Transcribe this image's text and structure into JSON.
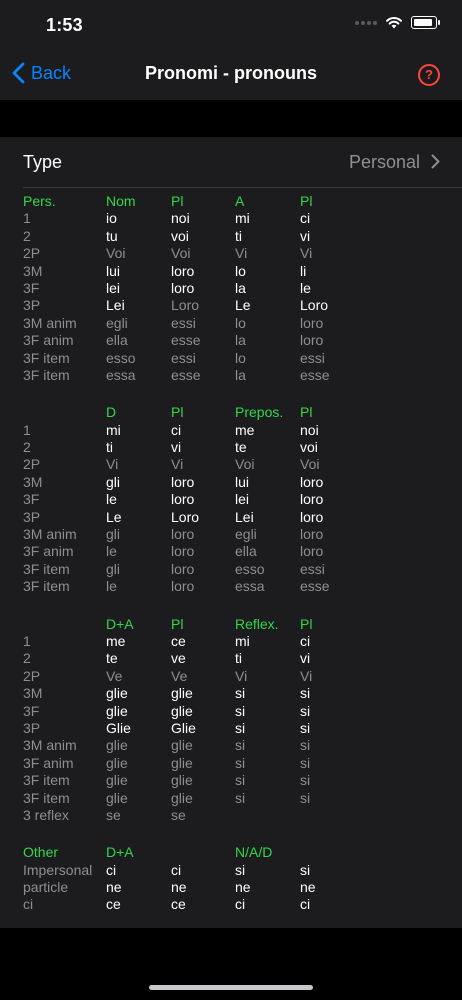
{
  "status": {
    "time": "1:53"
  },
  "nav": {
    "back_label": "Back",
    "title": "Pronomi - pronouns",
    "help_glyph": "?"
  },
  "type_row": {
    "label": "Type",
    "value": "Personal"
  },
  "tables": [
    {
      "header": [
        "Pers.",
        "Nom",
        "Pl",
        "A",
        "Pl"
      ],
      "rows": [
        {
          "c": [
            "1",
            "io",
            "noi",
            "mi",
            "ci"
          ],
          "s": [
            "g",
            "w",
            "w",
            "w",
            "w"
          ]
        },
        {
          "c": [
            "2",
            "tu",
            "voi",
            "ti",
            "vi"
          ],
          "s": [
            "g",
            "w",
            "w",
            "w",
            "w"
          ]
        },
        {
          "c": [
            "2P",
            "Voi",
            "Voi",
            "Vi",
            "Vi"
          ],
          "s": [
            "g",
            "g",
            "g",
            "g",
            "g"
          ]
        },
        {
          "c": [
            "3M",
            "lui",
            "loro",
            "lo",
            "li"
          ],
          "s": [
            "g",
            "w",
            "w",
            "w",
            "w"
          ]
        },
        {
          "c": [
            "3F",
            "lei",
            "loro",
            "la",
            "le"
          ],
          "s": [
            "g",
            "w",
            "w",
            "w",
            "w"
          ]
        },
        {
          "c": [
            "3P",
            "Lei",
            "Loro",
            "Le",
            "Loro"
          ],
          "s": [
            "g",
            "w",
            "g",
            "w",
            "w"
          ]
        },
        {
          "c": [
            "3M anim",
            "egli",
            "essi",
            "lo",
            "loro"
          ],
          "s": [
            "g",
            "g",
            "g",
            "g",
            "g"
          ]
        },
        {
          "c": [
            "3F anim",
            "ella",
            "esse",
            "la",
            "loro"
          ],
          "s": [
            "g",
            "g",
            "g",
            "g",
            "g"
          ]
        },
        {
          "c": [
            "3F item",
            "esso",
            "essi",
            "lo",
            "essi"
          ],
          "s": [
            "g",
            "g",
            "g",
            "g",
            "g"
          ]
        },
        {
          "c": [
            "3F item",
            "essa",
            "esse",
            "la",
            "esse"
          ],
          "s": [
            "g",
            "g",
            "g",
            "g",
            "g"
          ]
        }
      ]
    },
    {
      "header": [
        "",
        "D",
        "Pl",
        "Prepos.",
        "Pl"
      ],
      "rows": [
        {
          "c": [
            "1",
            "mi",
            "ci",
            "me",
            "noi"
          ],
          "s": [
            "g",
            "w",
            "w",
            "w",
            "w"
          ]
        },
        {
          "c": [
            "2",
            "ti",
            "vi",
            "te",
            "voi"
          ],
          "s": [
            "g",
            "w",
            "w",
            "w",
            "w"
          ]
        },
        {
          "c": [
            "2P",
            "Vi",
            "Vi",
            "Voi",
            "Voi"
          ],
          "s": [
            "g",
            "g",
            "g",
            "g",
            "g"
          ]
        },
        {
          "c": [
            "3M",
            "gli",
            "loro",
            "lui",
            "loro"
          ],
          "s": [
            "g",
            "w",
            "w",
            "w",
            "w"
          ]
        },
        {
          "c": [
            "3F",
            "le",
            "loro",
            "lei",
            "loro"
          ],
          "s": [
            "g",
            "w",
            "w",
            "w",
            "w"
          ]
        },
        {
          "c": [
            "3P",
            "Le",
            "Loro",
            "Lei",
            "loro"
          ],
          "s": [
            "g",
            "w",
            "w",
            "w",
            "w"
          ]
        },
        {
          "c": [
            "3M anim",
            "gli",
            "loro",
            "egli",
            "loro"
          ],
          "s": [
            "g",
            "g",
            "g",
            "g",
            "g"
          ]
        },
        {
          "c": [
            "3F anim",
            "le",
            "loro",
            "ella",
            "loro"
          ],
          "s": [
            "g",
            "g",
            "g",
            "g",
            "g"
          ]
        },
        {
          "c": [
            "3F item",
            "gli",
            "loro",
            "esso",
            "essi"
          ],
          "s": [
            "g",
            "g",
            "g",
            "g",
            "g"
          ]
        },
        {
          "c": [
            "3F item",
            "le",
            "loro",
            "essa",
            "esse"
          ],
          "s": [
            "g",
            "g",
            "g",
            "g",
            "g"
          ]
        }
      ]
    },
    {
      "header": [
        "",
        "D+A",
        "Pl",
        "Reflex.",
        "Pl"
      ],
      "rows": [
        {
          "c": [
            "1",
            "me",
            "ce",
            "mi",
            "ci"
          ],
          "s": [
            "g",
            "w",
            "w",
            "w",
            "w"
          ]
        },
        {
          "c": [
            "2",
            "te",
            "ve",
            "ti",
            "vi"
          ],
          "s": [
            "g",
            "w",
            "w",
            "w",
            "w"
          ]
        },
        {
          "c": [
            "2P",
            "Ve",
            "Ve",
            "Vi",
            "Vi"
          ],
          "s": [
            "g",
            "g",
            "g",
            "g",
            "g"
          ]
        },
        {
          "c": [
            "3M",
            "glie",
            "glie",
            "si",
            "si"
          ],
          "s": [
            "g",
            "w",
            "w",
            "w",
            "w"
          ]
        },
        {
          "c": [
            "3F",
            "glie",
            "glie",
            "si",
            "si"
          ],
          "s": [
            "g",
            "w",
            "w",
            "w",
            "w"
          ]
        },
        {
          "c": [
            "3P",
            "Glie",
            "Glie",
            "si",
            "si"
          ],
          "s": [
            "g",
            "w",
            "w",
            "w",
            "w"
          ]
        },
        {
          "c": [
            "3M anim",
            "glie",
            "glie",
            "si",
            "si"
          ],
          "s": [
            "g",
            "g",
            "g",
            "g",
            "g"
          ]
        },
        {
          "c": [
            "3F anim",
            "glie",
            "glie",
            "si",
            "si"
          ],
          "s": [
            "g",
            "g",
            "g",
            "g",
            "g"
          ]
        },
        {
          "c": [
            "3F item",
            "glie",
            "glie",
            "si",
            "si"
          ],
          "s": [
            "g",
            "g",
            "g",
            "g",
            "g"
          ]
        },
        {
          "c": [
            "3F item",
            "glie",
            "glie",
            "si",
            "si"
          ],
          "s": [
            "g",
            "g",
            "g",
            "g",
            "g"
          ]
        },
        {
          "c": [
            "3 reflex",
            "se",
            "se",
            "",
            ""
          ],
          "s": [
            "g",
            "g",
            "g",
            "g",
            "g"
          ]
        }
      ]
    },
    {
      "header": [
        "Other",
        "D+A",
        "",
        "N/A/D",
        ""
      ],
      "rows": [
        {
          "c": [
            "Impersonal",
            "ci",
            "ci",
            "si",
            "si"
          ],
          "s": [
            "g",
            "w",
            "w",
            "w",
            "w"
          ]
        },
        {
          "c": [
            "particle",
            "ne",
            "ne",
            "ne",
            "ne"
          ],
          "s": [
            "g",
            "w",
            "w",
            "w",
            "w"
          ]
        },
        {
          "c": [
            "ci",
            "ce",
            "ce",
            "ci",
            "ci"
          ],
          "s": [
            "g",
            "w",
            "w",
            "w",
            "w"
          ]
        }
      ]
    }
  ],
  "colors": {
    "accent": "#0a84ff",
    "header_green": "#32d74b",
    "help_red": "#ff453a",
    "muted": "#8e8e93"
  }
}
